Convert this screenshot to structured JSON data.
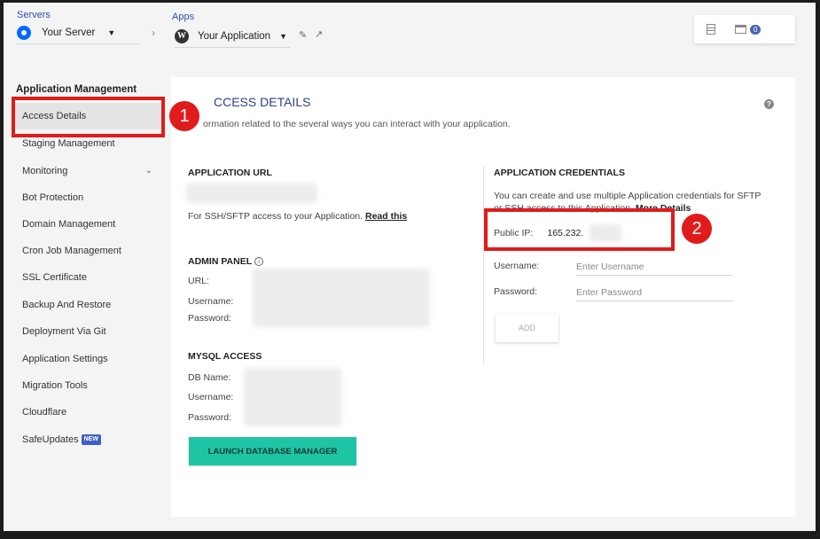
{
  "topbar": {
    "servers_label": "Servers",
    "server_name": "Your Server",
    "apps_label": "Apps",
    "app_name": "Your Application",
    "notification_count": "0"
  },
  "sidebar": {
    "title": "Application Management",
    "items": [
      {
        "label": "Access Details"
      },
      {
        "label": "Staging Management"
      },
      {
        "label": "Monitoring"
      },
      {
        "label": "Bot Protection"
      },
      {
        "label": "Domain Management"
      },
      {
        "label": "Cron Job Management"
      },
      {
        "label": "SSL Certificate"
      },
      {
        "label": "Backup And Restore"
      },
      {
        "label": "Deployment Via Git"
      },
      {
        "label": "Application Settings"
      },
      {
        "label": "Migration Tools"
      },
      {
        "label": "Cloudflare"
      },
      {
        "label": "SafeUpdates",
        "badge": "NEW"
      }
    ]
  },
  "annotations": {
    "marker1": "1",
    "marker2": "2"
  },
  "main": {
    "title": "CCESS DETAILS",
    "description": "ormation related to the several ways you can interact with your application.",
    "app_url": {
      "title": "APPLICATION URL",
      "ssh_text": "For SSH/SFTP access to your Application.",
      "read_this": "Read this"
    },
    "admin_panel": {
      "title": "ADMIN PANEL",
      "url_label": "URL:",
      "username_label": "Username:",
      "password_label": "Password:"
    },
    "mysql": {
      "title": "MYSQL ACCESS",
      "db_name_label": "DB Name:",
      "username_label": "Username:",
      "password_label": "Password:",
      "launch_button": "LAUNCH DATABASE MANAGER"
    },
    "credentials": {
      "title": "APPLICATION CREDENTIALS",
      "desc_line1": "You can create and use multiple Application credentials for SFTP",
      "desc_line2": "or SSH access to this Application.",
      "more_details": "More Details",
      "public_ip_label": "Public IP:",
      "public_ip_value": "165.232.",
      "username_label": "Username:",
      "username_placeholder": "Enter Username",
      "password_label": "Password:",
      "password_placeholder": "Enter Password",
      "add_button": "ADD"
    }
  },
  "colors": {
    "accent": "#2c3f8f",
    "launch": "#1fc4a5",
    "highlight": "#e01b1b"
  }
}
